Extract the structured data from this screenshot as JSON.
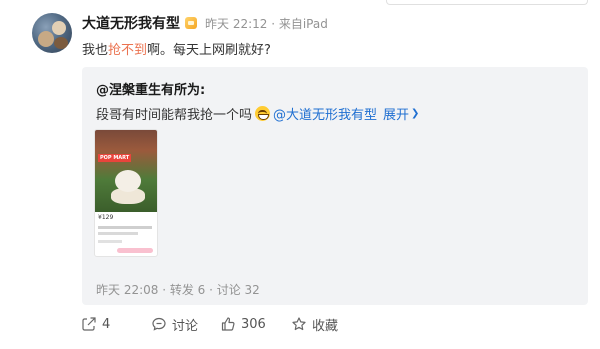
{
  "post": {
    "username": "大道无形我有型",
    "meta": "昨天 22:12 · 来自iPad",
    "text_before": "我也",
    "text_highlight": "抢不到",
    "text_after": "啊。每天上网刷就好?"
  },
  "quote": {
    "username": "@涅槃重生有所为:",
    "text": "段哥有时间能帮我抢一个吗",
    "mention": "@大道无形我有型",
    "expand_label": "展开",
    "stats": "昨天 22:08 · 转发 6 · 讨论 32",
    "thumbnail_badge": "POP MART",
    "thumbnail_price": "¥129"
  },
  "actions": {
    "share_count": "4",
    "comment_label": "讨论",
    "like_count": "306",
    "favorite_label": "收藏"
  },
  "colors": {
    "highlight": "#eb7350",
    "link": "#1f6fd1",
    "quote_bg": "#f2f3f5"
  }
}
